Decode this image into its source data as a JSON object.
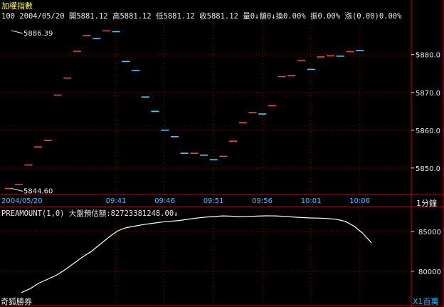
{
  "title": "加權指數",
  "quote": {
    "count": "100",
    "date": "2004/05/20",
    "open_label": "開",
    "open": "5881.12",
    "high_label": "高",
    "high": "5881.12",
    "low_label": "低",
    "low": "5881.12",
    "close_label": "收",
    "close": "5881.12",
    "volume_label": "量",
    "volume": "0↓",
    "amount_label": "額",
    "amount": "0↓",
    "turnover_label": "換",
    "turnover": "0.00%",
    "amplitude_label": "振",
    "amplitude": "0.00%",
    "change_label": "漲",
    "change": "(0.00)0.00%"
  },
  "interval": "1分鐘",
  "indicator_label": "PREAMOUNT(1,0) 大盤預估額:82723381248.00↓",
  "broker": "奇狐勝券",
  "unit_label": "X1百萬",
  "colors": {
    "up": "#ff4040",
    "down": "#40d0ff",
    "line": "#ffffff",
    "grid": "#8a0000",
    "accent": "#ffff40"
  },
  "chart_data": [
    {
      "type": "line",
      "title": "加權指數",
      "xlabel": "",
      "ylabel": "",
      "ylim": [
        5843,
        5889
      ],
      "y_ticks": [
        5850.0,
        5860.0,
        5870.0,
        5880.0
      ],
      "x_ticks": [
        "2004/05/20",
        "09:41",
        "09:46",
        "09:51",
        "09:56",
        "10:01",
        "10:06"
      ],
      "annotations": [
        {
          "text": "5886.39",
          "value": 5886.39
        },
        {
          "text": "5844.60",
          "value": 5844.6
        }
      ],
      "series": [
        {
          "values": [
            5844.6,
            5845.6,
            5850.8,
            5855.6,
            5857.3,
            5869.3,
            5873.8,
            5880.9,
            5885.1,
            5884.3,
            5886.3,
            5886.1,
            5878.2,
            5875.8,
            5868.8,
            5865.0,
            5860.0,
            5858.3,
            5853.9,
            5853.9,
            5853.4,
            5852.2,
            5853.1,
            5857.1,
            5862.0,
            5864.7,
            5864.3,
            5866.5,
            5874.2,
            5874.5,
            5878.4,
            5876.1,
            5879.4,
            5879.7,
            5879.6,
            5880.8,
            5881.1
          ],
          "directions": [
            "up",
            "up",
            "up",
            "up",
            "up",
            "up",
            "up",
            "up",
            "up",
            "down",
            "up",
            "down",
            "down",
            "down",
            "down",
            "down",
            "down",
            "down",
            "down",
            "up",
            "down",
            "down",
            "up",
            "up",
            "up",
            "up",
            "down",
            "up",
            "up",
            "up",
            "up",
            "down",
            "up",
            "up",
            "down",
            "up",
            "down"
          ]
        }
      ]
    },
    {
      "type": "line",
      "title": "PREAMOUNT(1,0)",
      "xlabel": "",
      "ylabel": "",
      "ylim": [
        77200,
        87800
      ],
      "y_ticks": [
        80000,
        85000
      ],
      "series": [
        {
          "values": [
            77300,
            77800,
            78500,
            79000,
            79500,
            80200,
            81000,
            81800,
            82500,
            83400,
            84300,
            85100,
            85500,
            85700,
            85900,
            86050,
            86200,
            86300,
            86400,
            86550,
            86700,
            86820,
            86900,
            86980,
            86950,
            86870,
            86920,
            86960,
            86990,
            86980,
            86930,
            86850,
            86780,
            86720,
            86700,
            86650,
            86550,
            86300,
            85700,
            84800,
            83600
          ]
        }
      ]
    }
  ]
}
